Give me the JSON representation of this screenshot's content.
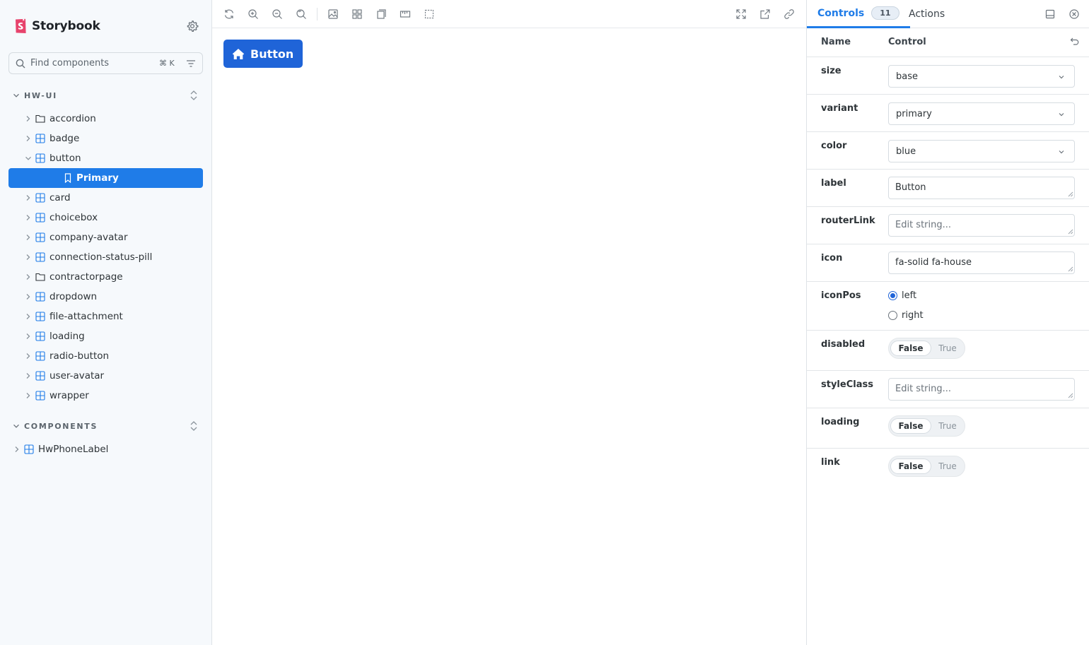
{
  "brand": {
    "name": "Storybook"
  },
  "search": {
    "placeholder": "Find components",
    "shortcut": "⌘ K"
  },
  "sidebar": {
    "sections": [
      {
        "title": "HW-UI",
        "items": [
          {
            "label": "accordion",
            "icon": "folder-icon"
          },
          {
            "label": "badge",
            "icon": "component-icon"
          },
          {
            "label": "button",
            "icon": "component-icon",
            "expanded": true
          },
          {
            "label": "Primary",
            "icon": "bookmark-icon",
            "selected": true
          },
          {
            "label": "card",
            "icon": "component-icon"
          },
          {
            "label": "choicebox",
            "icon": "component-icon"
          },
          {
            "label": "company-avatar",
            "icon": "component-icon"
          },
          {
            "label": "connection-status-pill",
            "icon": "component-icon"
          },
          {
            "label": "contractorpage",
            "icon": "folder-icon"
          },
          {
            "label": "dropdown",
            "icon": "component-icon"
          },
          {
            "label": "file-attachment",
            "icon": "component-icon"
          },
          {
            "label": "loading",
            "icon": "component-icon"
          },
          {
            "label": "radio-button",
            "icon": "component-icon"
          },
          {
            "label": "user-avatar",
            "icon": "component-icon"
          },
          {
            "label": "wrapper",
            "icon": "component-icon"
          }
        ]
      },
      {
        "title": "COMPONENTS",
        "items": [
          {
            "label": "HwPhoneLabel",
            "icon": "component-icon"
          }
        ]
      }
    ]
  },
  "preview": {
    "button_label": "Button",
    "button_color": "#1f64d8"
  },
  "panel": {
    "tabs": {
      "controls": "Controls",
      "controls_count": "11",
      "actions": "Actions"
    },
    "headers": {
      "name": "Name",
      "control": "Control"
    },
    "controls": {
      "size": {
        "name": "size",
        "value": "base"
      },
      "variant": {
        "name": "variant",
        "value": "primary"
      },
      "color": {
        "name": "color",
        "value": "blue"
      },
      "label": {
        "name": "label",
        "value": "Button"
      },
      "routerLink": {
        "name": "routerLink",
        "placeholder": "Edit string..."
      },
      "icon": {
        "name": "icon",
        "value": "fa-solid fa-house"
      },
      "iconPos": {
        "name": "iconPos",
        "options": [
          "left",
          "right"
        ],
        "selected": "left"
      },
      "disabled": {
        "name": "disabled",
        "false_label": "False",
        "true_label": "True"
      },
      "styleClass": {
        "name": "styleClass",
        "placeholder": "Edit string..."
      },
      "loading": {
        "name": "loading",
        "false_label": "False",
        "true_label": "True"
      },
      "link": {
        "name": "link",
        "false_label": "False",
        "true_label": "True"
      }
    }
  },
  "colors": {
    "accent": "#1f7ce8",
    "brand": "#e7436c"
  }
}
